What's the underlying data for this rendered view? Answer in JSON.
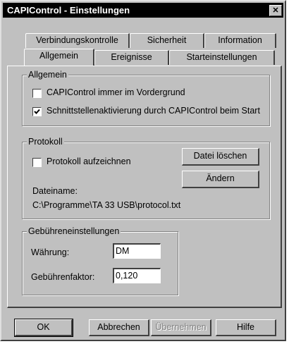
{
  "window": {
    "title": "CAPIControl - Einstellungen",
    "close_glyph": "✕"
  },
  "tabs": {
    "row1": [
      "Verbindungskontrolle",
      "Sicherheit",
      "Information"
    ],
    "row2": [
      "Allgemein",
      "Ereignisse",
      "Starteinstellungen"
    ],
    "active": "Allgemein"
  },
  "allgemein": {
    "legend": "Allgemein",
    "options": [
      {
        "label": "CAPIControl immer im Vordergrund",
        "checked": false
      },
      {
        "label": "Schnittstellenaktivierung durch CAPIControl beim Start",
        "checked": true
      }
    ]
  },
  "protokoll": {
    "legend": "Protokoll",
    "record_label": "Protokoll aufzeichnen",
    "record_checked": false,
    "delete_button": "Datei löschen",
    "change_button": "Ändern",
    "filename_label": "Dateiname:",
    "filename_value": "C:\\Programme\\TA 33 USB\\protocol.txt"
  },
  "gebuehren": {
    "legend": "Gebühreneinstellungen",
    "currency_label": "Währung:",
    "currency_value": "DM",
    "factor_label": "Gebührenfaktor:",
    "factor_value": "0,120"
  },
  "buttons": {
    "ok": "OK",
    "cancel": "Abbrechen",
    "apply": "Übernehmen",
    "help": "Hilfe"
  },
  "colors": {
    "face": "#c0c0c0",
    "title_bar": "#000000"
  }
}
